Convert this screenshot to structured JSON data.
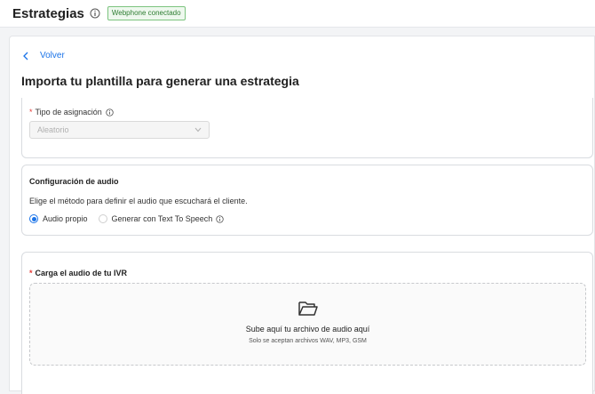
{
  "header": {
    "title": "Estrategias",
    "badge": "Webphone conectado"
  },
  "nav": {
    "back_label": "Volver"
  },
  "main": {
    "heading": "Importa tu plantilla para generar una estrategia"
  },
  "assignment": {
    "required_mark": "*",
    "label": "Tipo de asignación",
    "selected_value": "Aleatorio"
  },
  "audio_config": {
    "title": "Configuración de audio",
    "description": "Elige el método para definir el audio que escuchará el cliente.",
    "options": [
      {
        "label": "Audio propio",
        "selected": true
      },
      {
        "label": "Generar con Text To Speech",
        "selected": false
      }
    ]
  },
  "upload": {
    "required_mark": "*",
    "label": "Carga el audio de tu IVR",
    "drop_title": "Sube aquí tu archivo de audio aquí",
    "drop_subtitle": "Solo se aceptan archivos WAV, MP3, GSM"
  },
  "colors": {
    "accent": "#1a73e8",
    "required": "#e53935",
    "badge_text": "#2e7d32"
  }
}
